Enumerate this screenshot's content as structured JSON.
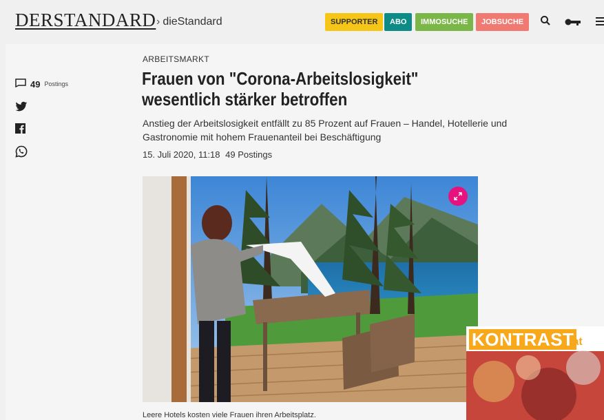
{
  "header": {
    "logo": "DERSTANDARD",
    "breadcrumb_sep": "›",
    "breadcrumb": "dieStandard",
    "buttons": {
      "supporter": "SUPPORTER",
      "abo": "ABO",
      "immo": "IMMOSUCHE",
      "jobs": "JOBSUCHE"
    },
    "icons": [
      "search-icon",
      "key-icon",
      "menu-icon"
    ]
  },
  "sidebar": {
    "postings_count": "49",
    "postings_label": "Postings",
    "share_icons": [
      "twitter-icon",
      "facebook-icon",
      "whatsapp-icon"
    ]
  },
  "article": {
    "category": "ARBEITSMARKT",
    "title": "Frauen von \"Corona-Arbeitslosigkeit\" wesentlich stärker betroffen",
    "lead": "Anstieg der Arbeitslosigkeit entfällt zu 85 Prozent auf Frauen – Handel, Hotellerie und Gastronomie mit hohem Frauenanteil bei Beschäftigung",
    "date": "15. Juli 2020, 11:18",
    "postings_meta": "49 Postings",
    "caption": "Leere Hotels kosten viele Frauen ihren Arbeitsplatz."
  },
  "ad": {
    "brand": "KONTRAST",
    "tld": ".at"
  },
  "colors": {
    "supporter": "#f5c518",
    "abo": "#0e8b86",
    "immo": "#7ab648",
    "jobs": "#f07a72",
    "expand": "#e6127e",
    "kontrast": "#f7a81b"
  }
}
